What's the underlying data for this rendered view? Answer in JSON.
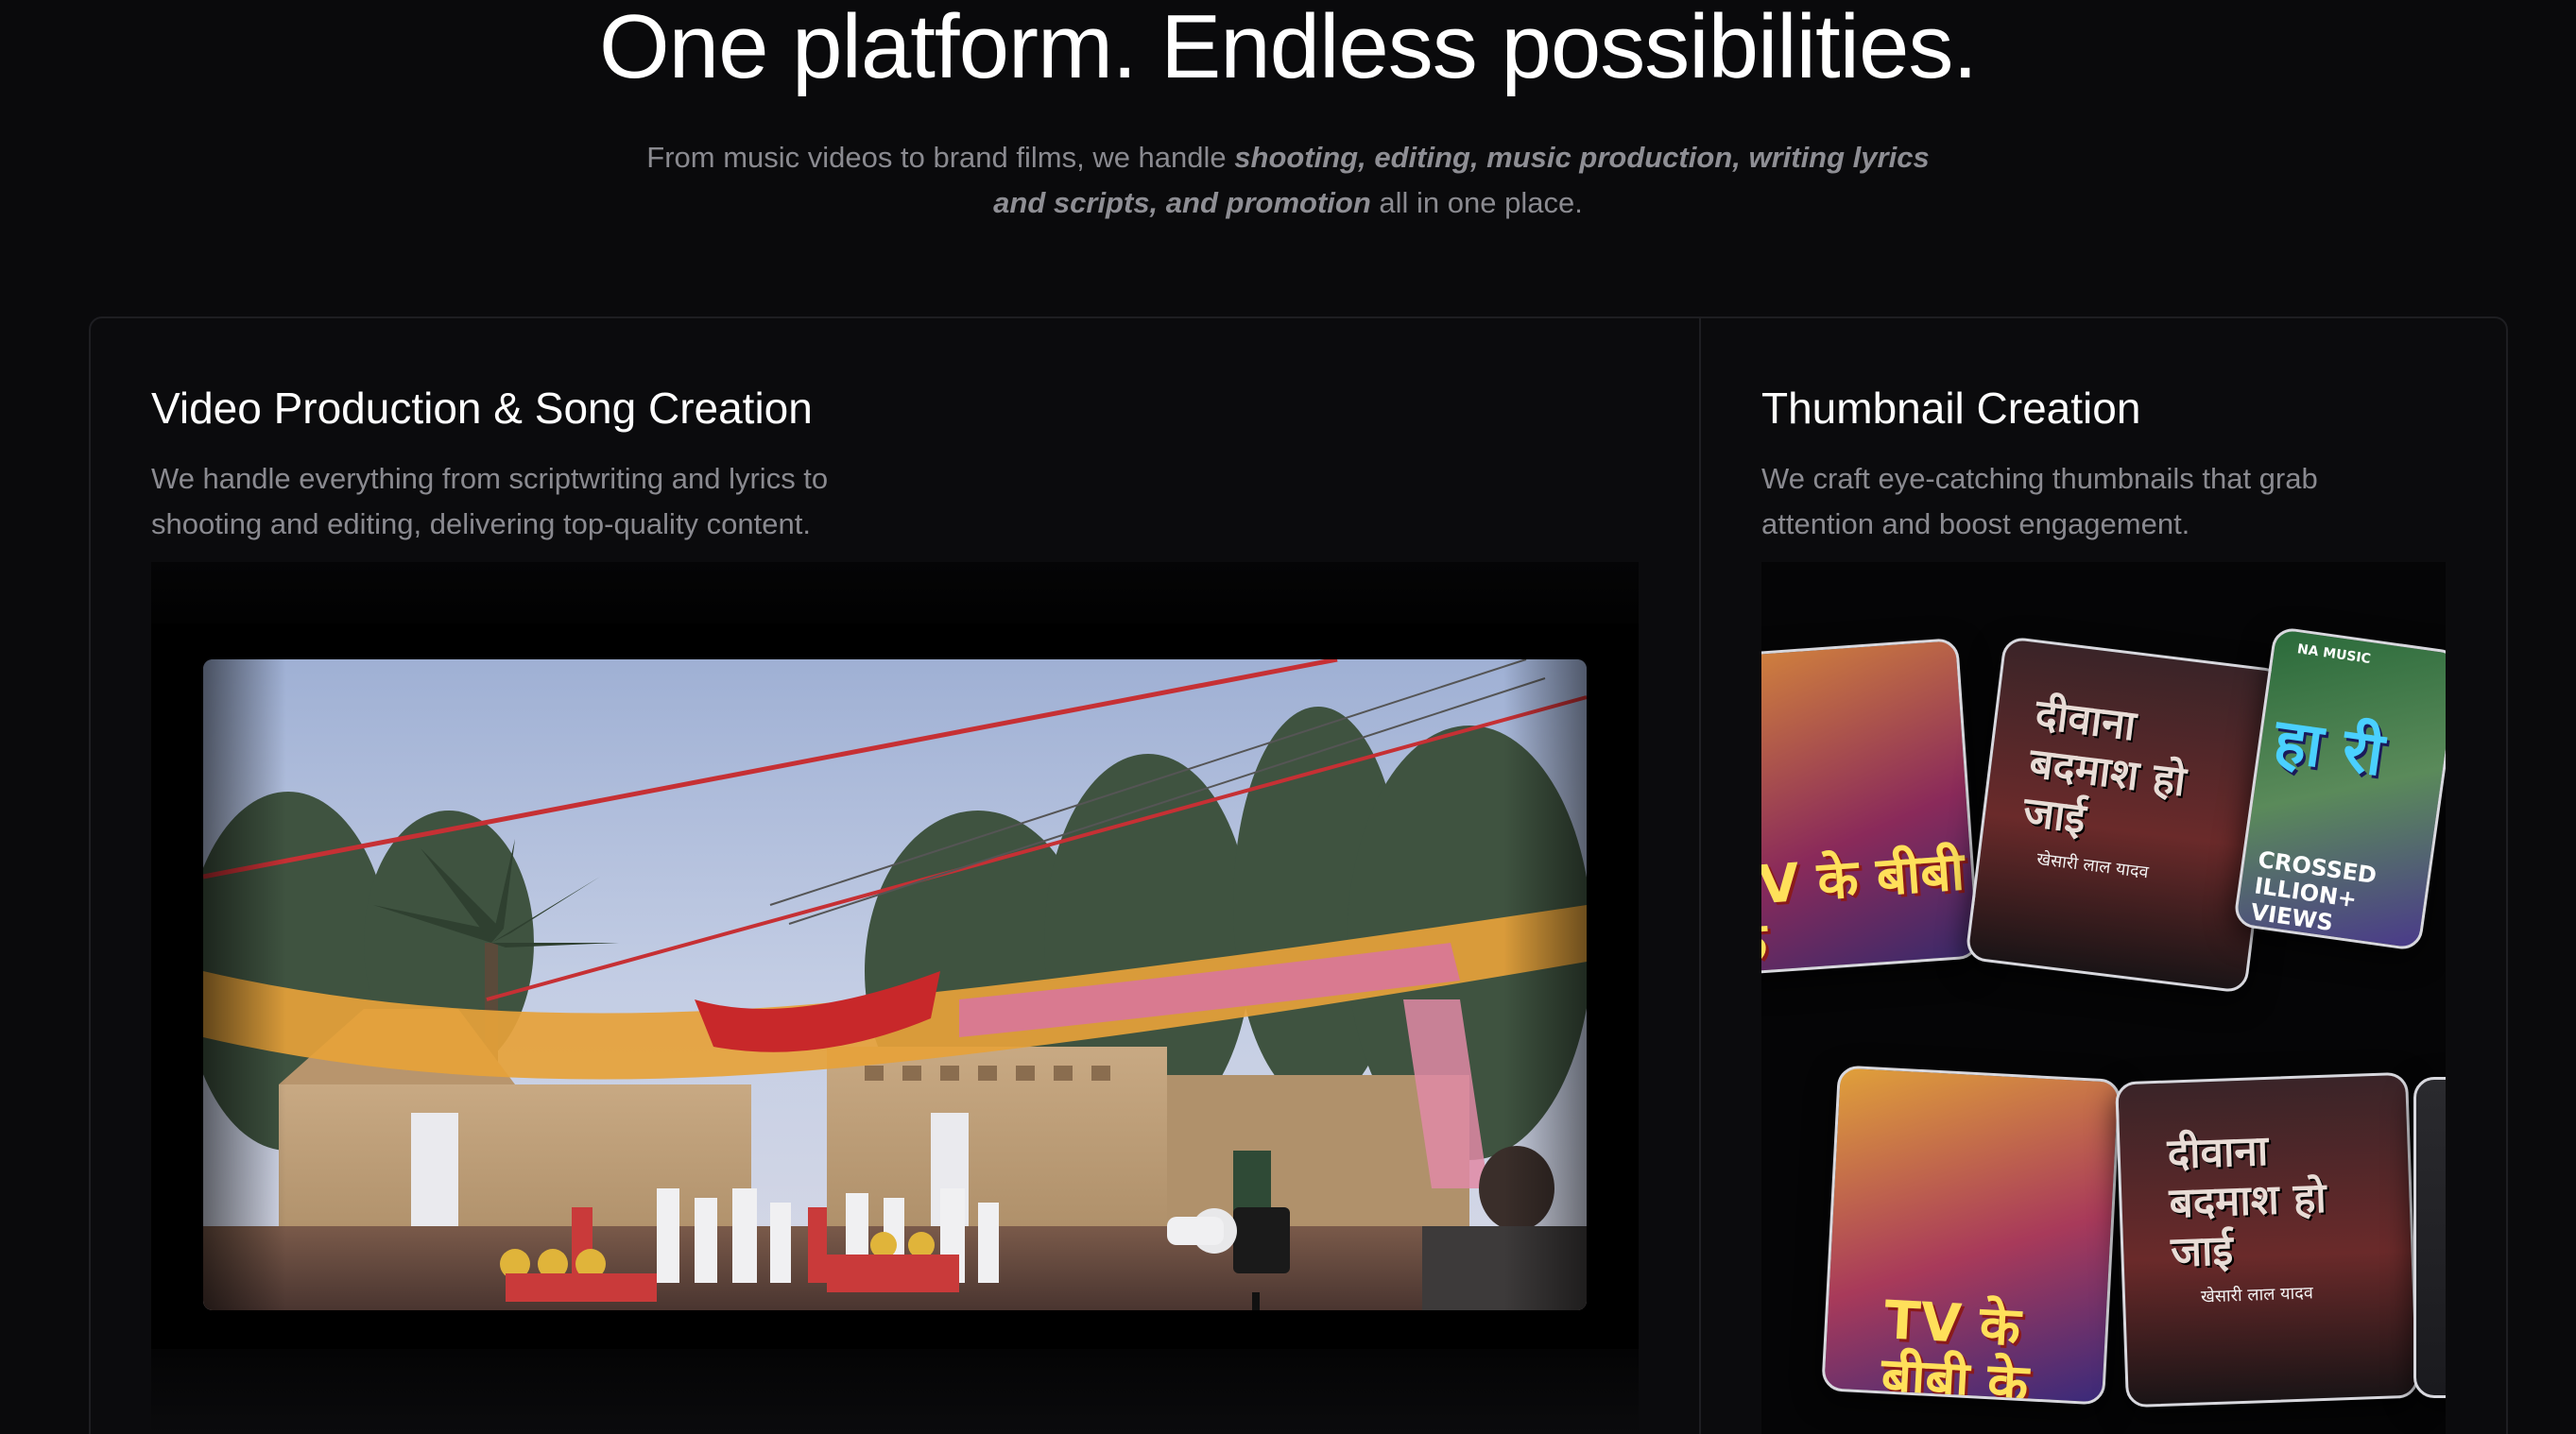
{
  "hero": {
    "title": "One platform. Endless possibilities.",
    "subtitle_lead": "From music videos to brand films, we handle ",
    "subtitle_emphasis": "shooting, editing, music production, writing lyrics and scripts, and promotion",
    "subtitle_tail": " all in one place."
  },
  "cards": [
    {
      "title": "Video Production & Song Creation",
      "description_line1": "We handle everything from scriptwriting and lyrics to",
      "description_line2": "shooting and editing, delivering top-quality content."
    },
    {
      "title": "Thumbnail Creation",
      "description_line1": "We craft eye-catching thumbnails that grab",
      "description_line2": "attention and boost engagement."
    }
  ],
  "thumbnails": {
    "poster_a_title": "TV के बीबी के",
    "poster_b_title": "दीवाना बदमाश हो जाई",
    "poster_b_credit": "खेसारी लाल यादव",
    "poster_c_badge": "CROSSED ILLION+ VIEWS",
    "poster_c_label": "NA MUSIC",
    "poster_c_title": "हा री"
  },
  "colors": {
    "background": "#0a0a0c",
    "panel_border": "#1e1e22",
    "muted_text": "#8a8a90"
  }
}
